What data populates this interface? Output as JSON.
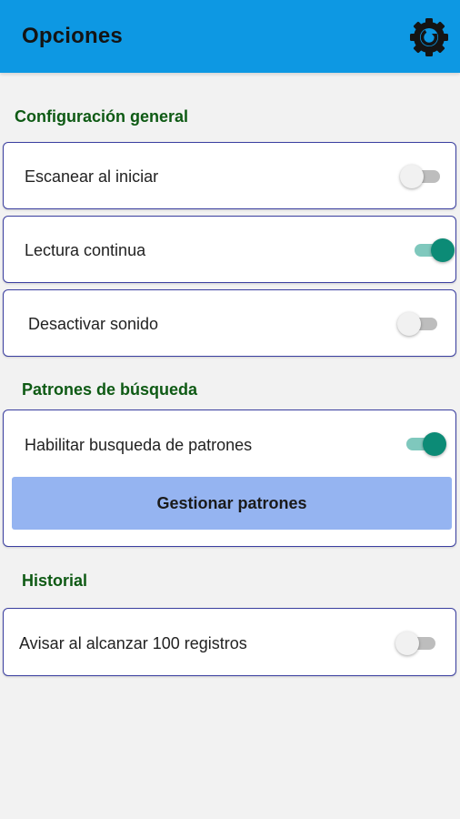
{
  "header": {
    "title": "Opciones",
    "settings_icon": "gear-icon",
    "background_color": "#0d98e3"
  },
  "sections": {
    "general": {
      "title": "Configuración general",
      "items": [
        {
          "label": "Escanear al iniciar",
          "enabled": false
        },
        {
          "label": "Lectura continua",
          "enabled": true
        },
        {
          "label": "Desactivar sonido",
          "enabled": false
        }
      ]
    },
    "patterns": {
      "title": "Patrones de búsqueda",
      "items": [
        {
          "label": "Habilitar busqueda de patrones",
          "enabled": true
        }
      ],
      "manage_button_label": "Gestionar patrones"
    },
    "history": {
      "title": "Historial",
      "items": [
        {
          "label": "Avisar al alcanzar 100 registros",
          "enabled": false
        }
      ]
    }
  },
  "colors": {
    "section_title": "#0e5a14",
    "switch_on": "#0c8b76",
    "card_border": "#3b3fa0",
    "button_bg": "#95b4f1"
  }
}
